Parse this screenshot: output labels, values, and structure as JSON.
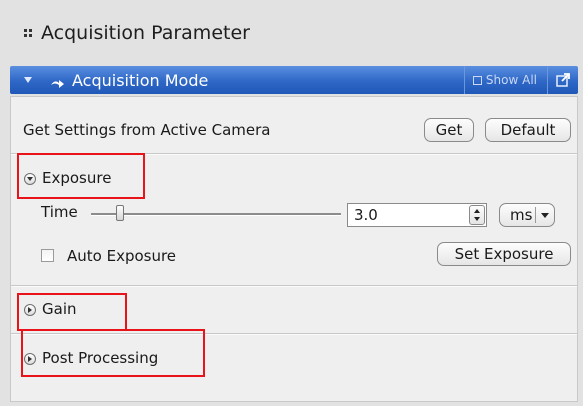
{
  "panel": {
    "title": "Acquisition Parameter",
    "grip_icon": "grip-dots-icon"
  },
  "section": {
    "title": "Acquisition Mode",
    "mode_icon": "acquisition-mode-icon",
    "show_all_label": "Show All",
    "popout_icon": "popout-icon",
    "accent_color": "#2e67c6"
  },
  "settings": {
    "label": "Get Settings from Active Camera",
    "get_button": "Get",
    "default_button": "Default"
  },
  "exposure": {
    "title": "Exposure",
    "expanded": true,
    "time_label": "Time",
    "time_value": "3.0",
    "unit": "ms",
    "auto_exposure_label": "Auto Exposure",
    "auto_exposure_checked": false,
    "set_exposure_button": "Set Exposure"
  },
  "gain": {
    "title": "Gain",
    "expanded": false
  },
  "post_processing": {
    "title": "Post Processing",
    "expanded": false
  },
  "highlight_color": "#e8141a"
}
